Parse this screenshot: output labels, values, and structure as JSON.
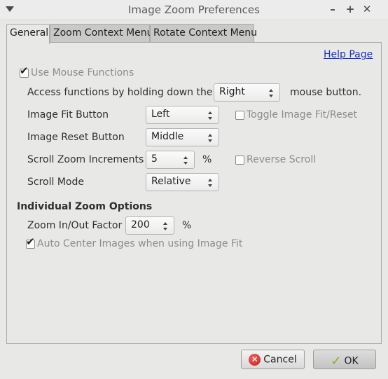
{
  "window": {
    "title": "Image Zoom Preferences"
  },
  "tabs": [
    {
      "label": "General"
    },
    {
      "label": "Zoom Context Menu"
    },
    {
      "label": "Rotate Context Menu"
    }
  ],
  "general": {
    "help_link": "Help Page",
    "use_mouse_functions": {
      "label": "Use Mouse Functions",
      "checked": true
    },
    "access": {
      "prefix": "Access functions by holding down the",
      "value": "Right",
      "suffix": "mouse button."
    },
    "image_fit": {
      "label": "Image Fit Button",
      "value": "Left",
      "toggle_label": "Toggle Image Fit/Reset",
      "toggle_checked": false
    },
    "image_reset": {
      "label": "Image Reset Button",
      "value": "Middle"
    },
    "scroll_zoom": {
      "label": "Scroll Zoom Increments",
      "value": "5",
      "unit": "%",
      "reverse_label": "Reverse Scroll",
      "reverse_checked": false
    },
    "scroll_mode": {
      "label": "Scroll Mode",
      "value": "Relative"
    },
    "individual_heading": "Individual Zoom Options",
    "zoom_factor": {
      "label": "Zoom In/Out Factor",
      "value": "200",
      "unit": "%"
    },
    "auto_center": {
      "label": "Auto Center Images when using Image Fit",
      "checked": true
    }
  },
  "buttons": {
    "cancel": "Cancel",
    "ok": "OK"
  },
  "icons": {
    "menu": "triangle-down-icon",
    "minimize": "minimize-icon",
    "maximize": "maximize-icon",
    "close": "close-icon",
    "cancel": "cancel-icon",
    "ok": "checkmark-icon"
  }
}
